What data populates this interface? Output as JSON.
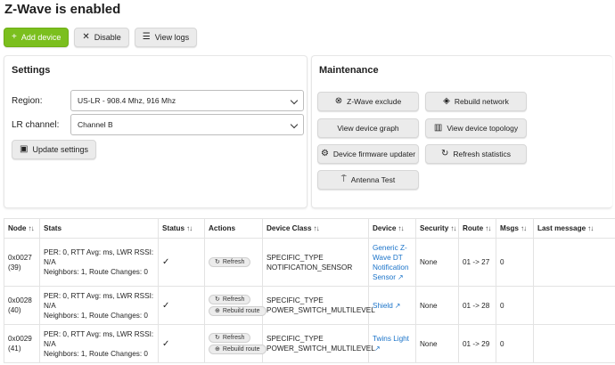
{
  "page": {
    "title": "Z-Wave is enabled"
  },
  "toolbar": {
    "add_device": "Add device",
    "disable": "Disable",
    "view_logs": "View logs"
  },
  "settings": {
    "title": "Settings",
    "region_label": "Region:",
    "region_value": "US-LR - 908.4 Mhz, 916 Mhz",
    "lr_label": "LR channel:",
    "lr_value": "Channel B",
    "update_button": "Update settings"
  },
  "maintenance": {
    "title": "Maintenance",
    "buttons": [
      {
        "label": "Z-Wave exclude",
        "icon": "exclude-icon"
      },
      {
        "label": "Rebuild network",
        "icon": "network-icon"
      },
      {
        "label": "View device graph",
        "icon": ""
      },
      {
        "label": "View device topology",
        "icon": "map-icon"
      },
      {
        "label": "Device firmware updater",
        "icon": "firmware-icon"
      },
      {
        "label": "Refresh statistics",
        "icon": "refresh-icon"
      },
      {
        "label": "Antenna Test",
        "icon": "antenna-icon"
      }
    ]
  },
  "table": {
    "headers": [
      "Node",
      "Stats",
      "Status",
      "Actions",
      "Device Class",
      "Device",
      "Security",
      "Route",
      "Msgs",
      "Last message"
    ],
    "rows": [
      {
        "node": "0x0027 (39)",
        "stats_line1": "PER: 0, RTT Avg: ms, LWR RSSI: N/A",
        "stats_line2": "Neighbors: 1, Route Changes: 0",
        "status": "✓",
        "actions": [
          "Refresh"
        ],
        "class_line1": "SPECIFIC_TYPE",
        "class_line2": "NOTIFICATION_SENSOR",
        "device": "Generic Z-Wave DT Notification Sensor",
        "security": "None",
        "route": "01 -> 27",
        "msgs": "0",
        "last_message": ""
      },
      {
        "node": "0x0028 (40)",
        "stats_line1": "PER: 0, RTT Avg: ms, LWR RSSI: N/A",
        "stats_line2": "Neighbors: 1, Route Changes: 0",
        "status": "✓",
        "actions": [
          "Refresh",
          "Rebuild route"
        ],
        "class_line1": "SPECIFIC_TYPE",
        "class_line2": "POWER_SWITCH_MULTILEVEL",
        "device": "Shield",
        "security": "None",
        "route": "01 -> 28",
        "msgs": "0",
        "last_message": ""
      },
      {
        "node": "0x0029 (41)",
        "stats_line1": "PER: 0, RTT Avg: ms, LWR RSSI: N/A",
        "stats_line2": "Neighbors: 1, Route Changes: 0",
        "status": "✓",
        "actions": [
          "Refresh",
          "Rebuild route"
        ],
        "class_line1": "SPECIFIC_TYPE",
        "class_line2": "POWER_SWITCH_MULTILEVEL",
        "device": "Twins Light",
        "security": "None",
        "route": "01 -> 29",
        "msgs": "0",
        "last_message": ""
      }
    ]
  },
  "colors": {
    "primary": "#7bbf1e",
    "link": "#1a73c9"
  }
}
